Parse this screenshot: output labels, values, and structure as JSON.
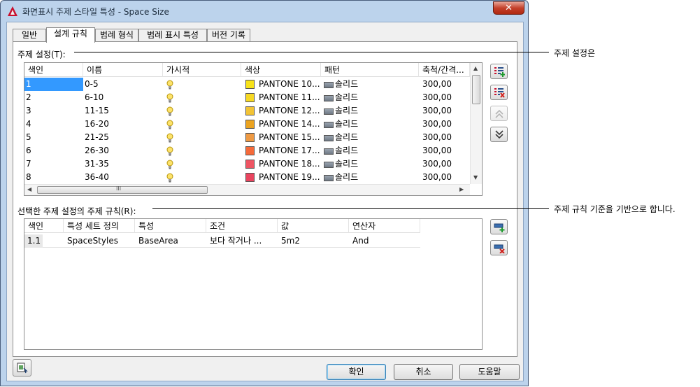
{
  "window": {
    "title": "화면표시 주제 스타일 특성 - Space Size",
    "close_label": "✕"
  },
  "tabs": [
    {
      "label": "일반"
    },
    {
      "label": "설계 규칙"
    },
    {
      "label": "범례 형식"
    },
    {
      "label": "범례 표시 특성"
    },
    {
      "label": "버전 기록"
    }
  ],
  "theme_settings": {
    "label": "주제 설정(T):",
    "columns": [
      "색인",
      "이름",
      "가시적",
      "색상",
      "패턴",
      "축척/간격..."
    ],
    "rows": [
      {
        "index": "1",
        "name": "0-5",
        "color": "PANTONE 10...",
        "swatch": "#f7e21a",
        "pattern": "솔리드",
        "scale": "300,00"
      },
      {
        "index": "2",
        "name": "6-10",
        "color": "PANTONE 11...",
        "swatch": "#f6d824",
        "pattern": "솔리드",
        "scale": "300,00"
      },
      {
        "index": "3",
        "name": "11-15",
        "color": "PANTONE 12...",
        "swatch": "#f2c335",
        "pattern": "솔리드",
        "scale": "300,00"
      },
      {
        "index": "4",
        "name": "16-20",
        "color": "PANTONE 14...",
        "swatch": "#eba321",
        "pattern": "솔리드",
        "scale": "300,00"
      },
      {
        "index": "5",
        "name": "21-25",
        "color": "PANTONE 15...",
        "swatch": "#ee9a44",
        "pattern": "솔리드",
        "scale": "300,00"
      },
      {
        "index": "6",
        "name": "26-30",
        "color": "PANTONE 17...",
        "swatch": "#f56a3a",
        "pattern": "솔리드",
        "scale": "300,00"
      },
      {
        "index": "7",
        "name": "31-35",
        "color": "PANTONE 18...",
        "swatch": "#ee5563",
        "pattern": "솔리드",
        "scale": "300,00"
      },
      {
        "index": "8",
        "name": "36-40",
        "color": "PANTONE 19...",
        "swatch": "#e9455f",
        "pattern": "솔리드",
        "scale": "300,00"
      }
    ],
    "hscroll_marker": "III"
  },
  "theme_rules": {
    "label": "선택한 주제 설정의 주제 규칙(R):",
    "columns": [
      "색인",
      "특성 세트 정의",
      "특성",
      "조건",
      "값",
      "연산자"
    ],
    "rows": [
      {
        "index": "1.1",
        "property_set": "SpaceStyles",
        "property": "BaseArea",
        "condition": "보다 작거나 ...",
        "value": "5m2",
        "operator": "And"
      }
    ]
  },
  "buttons": {
    "ok": "확인",
    "cancel": "취소",
    "help": "도움말"
  },
  "callouts": {
    "settings": "주제 설정은",
    "rules": "주제 규칙 기준을 기반으로 합니다."
  }
}
